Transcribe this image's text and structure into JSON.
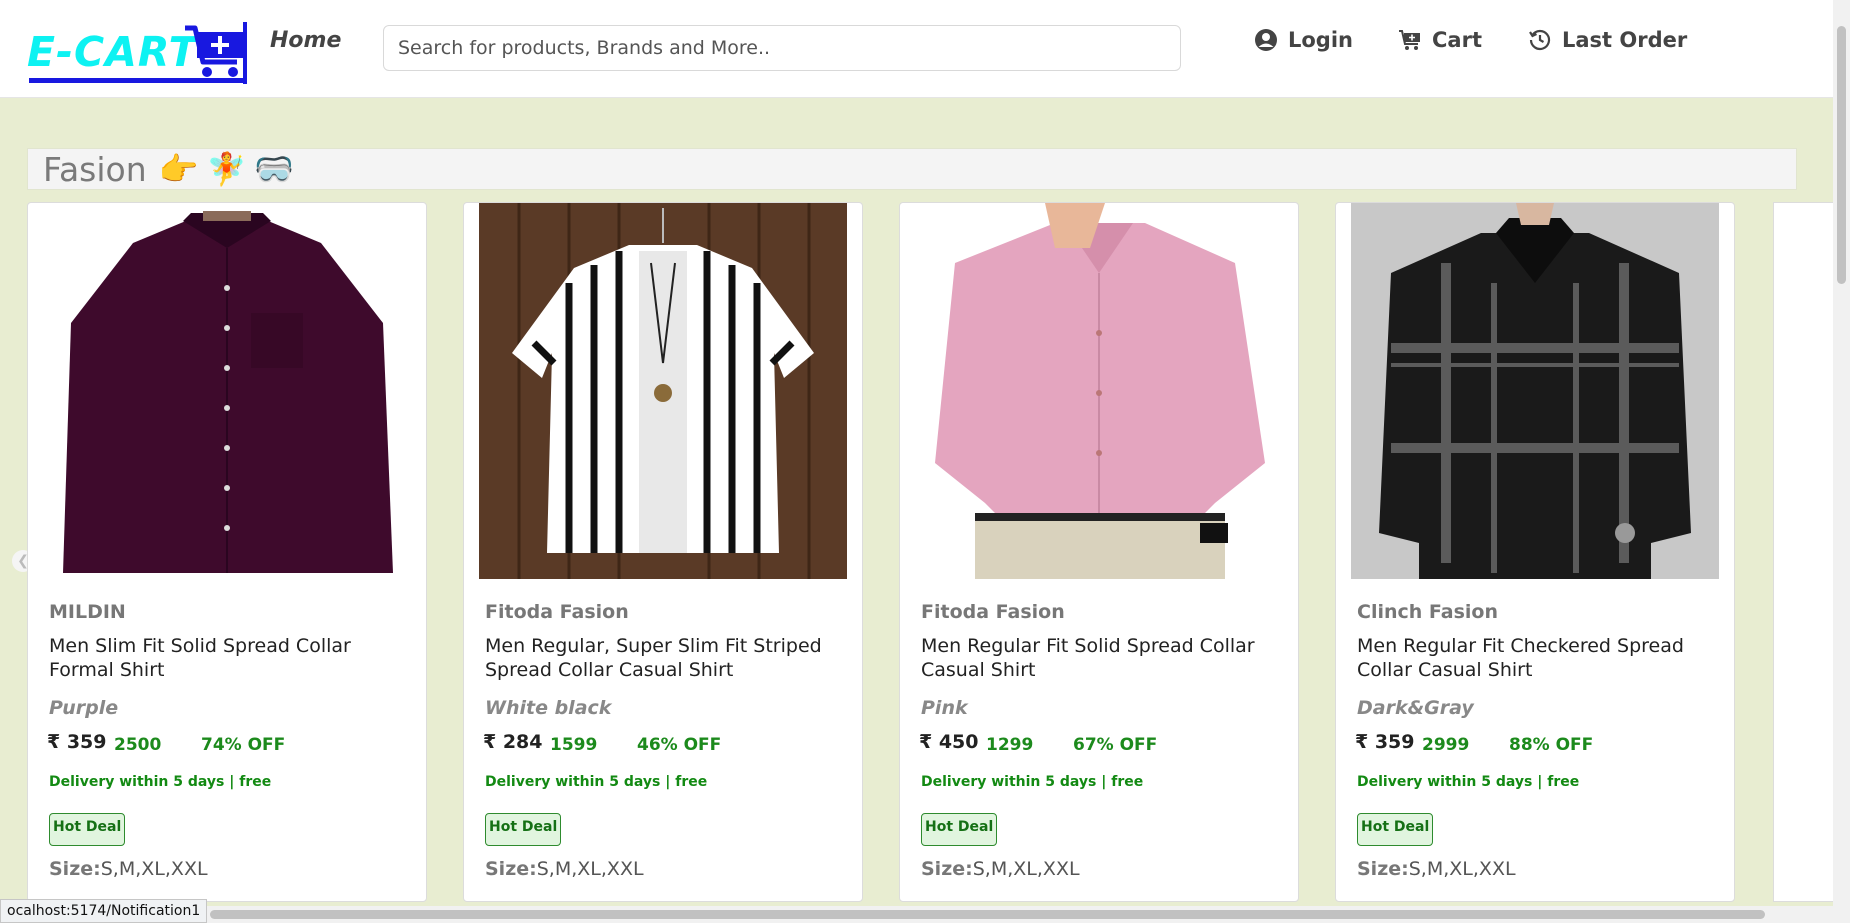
{
  "header": {
    "logo_text": "E-CART",
    "home_label": "Home",
    "search_placeholder": "Search for products, Brands and More..",
    "login_label": "Login",
    "cart_label": "Cart",
    "last_order_label": "Last Order",
    "colors": {
      "logo": "#0df2f2",
      "logo_underline": "#1818e0"
    }
  },
  "category": {
    "title": "Fasion",
    "emojis": [
      "👉",
      "🧚",
      "🥽"
    ]
  },
  "products": [
    {
      "brand": "MILDIN",
      "name": "Men Slim Fit Solid Spread Collar Formal Shirt",
      "color": "Purple",
      "price": "₹ 359",
      "mrp": "2500",
      "off": "74% OFF",
      "delivery": "Delivery within 5 days | free",
      "badge": "Hot Deal",
      "size_label": "Size:",
      "sizes": "S,M,XL,XXL"
    },
    {
      "brand": "Fitoda Fasion",
      "name": "Men Regular, Super Slim Fit Striped Spread Collar Casual Shirt",
      "color": "White black",
      "price": "₹ 284",
      "mrp": "1599",
      "off": "46% OFF",
      "delivery": "Delivery within 5 days | free",
      "badge": "Hot Deal",
      "size_label": "Size:",
      "sizes": "S,M,XL,XXL"
    },
    {
      "brand": "Fitoda Fasion",
      "name": "Men Regular Fit Solid Spread Collar Casual Shirt",
      "color": "Pink",
      "price": "₹ 450",
      "mrp": "1299",
      "off": "67% OFF",
      "delivery": "Delivery within 5 days | free",
      "badge": "Hot Deal",
      "size_label": "Size:",
      "sizes": "S,M,XL,XXL"
    },
    {
      "brand": "Clinch Fasion",
      "name": "Men Regular Fit Checkered Spread Collar Casual Shirt",
      "color": "Dark&Gray",
      "price": "₹ 359",
      "mrp": "2999",
      "off": "88% OFF",
      "delivery": "Delivery within 5 days | free",
      "badge": "Hot Deal",
      "size_label": "Size:",
      "sizes": "S,M,XL,XXL"
    }
  ],
  "carousel": {
    "prev_icon": "chevron-left-icon",
    "next_icon": "chevron-right-icon"
  },
  "status_bar": {
    "url": "ocalhost:5174/Notification1"
  }
}
